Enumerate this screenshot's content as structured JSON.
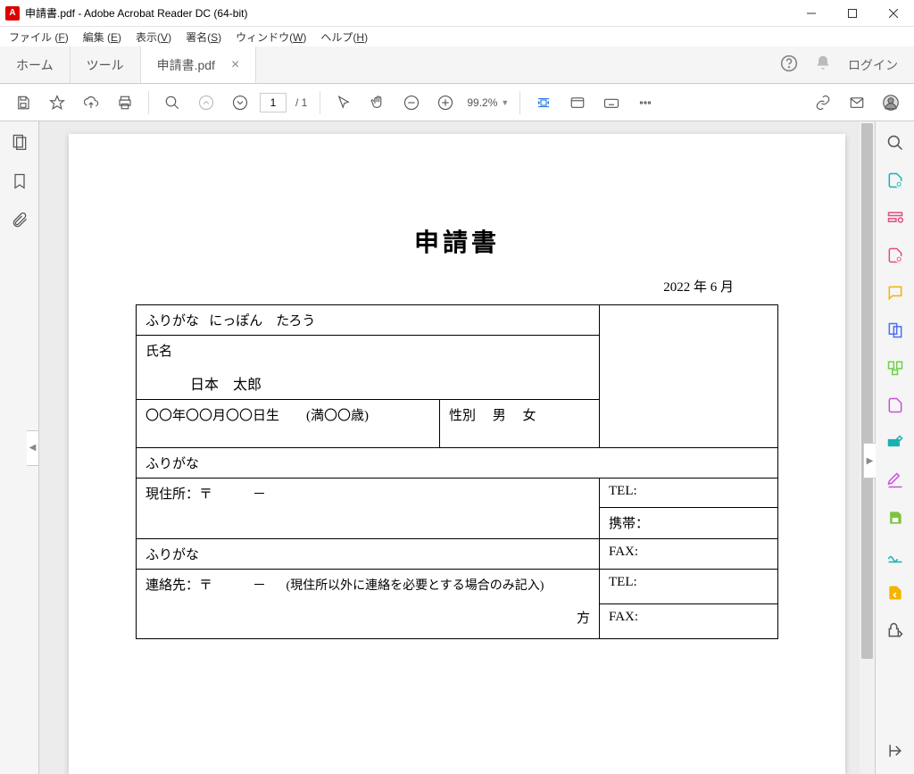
{
  "window": {
    "title": "申請書.pdf - Adobe Acrobat Reader DC (64-bit)"
  },
  "menu": {
    "file": {
      "label": "ファイル (",
      "accel": "F",
      "suffix": ")"
    },
    "edit": {
      "label": "編集 (",
      "accel": "E",
      "suffix": ")"
    },
    "view": {
      "label": "表示(",
      "accel": "V",
      "suffix": ")"
    },
    "sign": {
      "label": "署名(",
      "accel": "S",
      "suffix": ")"
    },
    "window": {
      "label": "ウィンドウ(",
      "accel": "W",
      "suffix": ")"
    },
    "help": {
      "label": "ヘルプ(",
      "accel": "H",
      "suffix": ")"
    }
  },
  "tabs": {
    "home": "ホーム",
    "tools": "ツール",
    "document": "申請書.pdf",
    "login": "ログイン"
  },
  "toolbar": {
    "page_current": "1",
    "page_total": "/ 1",
    "zoom_level": "99.2%"
  },
  "document": {
    "title": "申請書",
    "date": "2022 年 6 月",
    "furigana_label1": "ふりがな",
    "furigana_value1": "にっぽん　たろう",
    "name_label": "氏名",
    "name_value": "日本　太郎",
    "birth_line": "〇〇年〇〇月〇〇日生　　(満〇〇歳)",
    "gender_line": "性別　 男　 女",
    "furigana_label2": "ふりがな",
    "address_label": "現住所：〒　　　－",
    "tel_label": "TEL:",
    "mobile_label": "携帯：",
    "furigana_label3": "ふりがな",
    "fax_label1": "FAX:",
    "contact_label": "連絡先：〒　　　－",
    "contact_note": "(現住所以外に連絡を必要とする場合のみ記入)",
    "contact_kata": "方",
    "tel_label2": "TEL:",
    "fax_label2": "FAX:"
  }
}
